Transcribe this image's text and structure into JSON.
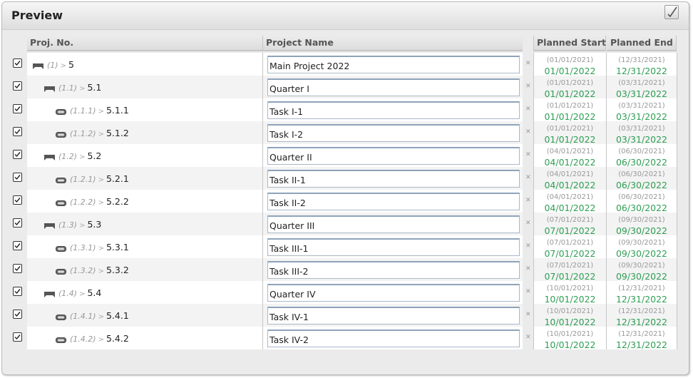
{
  "window": {
    "title": "Preview"
  },
  "columns": {
    "proj_no": "Proj. No.",
    "project_name": "Project Name",
    "planned_start": "Planned Start",
    "planned_end": "Planned End"
  },
  "rows": [
    {
      "checked": true,
      "type": "summary",
      "level": 0,
      "wbs": "(1)",
      "num": "5",
      "name": "Main Project 2022",
      "start_old": "(01/01/2021)",
      "start_new": "01/01/2022",
      "end_old": "(12/31/2021)",
      "end_new": "12/31/2022"
    },
    {
      "checked": true,
      "type": "summary",
      "level": 1,
      "wbs": "(1.1)",
      "num": "5.1",
      "name": "Quarter I",
      "start_old": "(01/01/2021)",
      "start_new": "01/01/2022",
      "end_old": "(03/31/2021)",
      "end_new": "03/31/2022"
    },
    {
      "checked": true,
      "type": "task",
      "level": 2,
      "wbs": "(1.1.1)",
      "num": "5.1.1",
      "name": "Task I-1",
      "start_old": "(01/01/2021)",
      "start_new": "01/01/2022",
      "end_old": "(03/31/2021)",
      "end_new": "03/31/2022"
    },
    {
      "checked": true,
      "type": "task",
      "level": 2,
      "wbs": "(1.1.2)",
      "num": "5.1.2",
      "name": "Task I-2",
      "start_old": "(01/01/2021)",
      "start_new": "01/01/2022",
      "end_old": "(03/31/2021)",
      "end_new": "03/31/2022"
    },
    {
      "checked": true,
      "type": "summary",
      "level": 1,
      "wbs": "(1.2)",
      "num": "5.2",
      "name": "Quarter II",
      "start_old": "(04/01/2021)",
      "start_new": "04/01/2022",
      "end_old": "(06/30/2021)",
      "end_new": "06/30/2022"
    },
    {
      "checked": true,
      "type": "task",
      "level": 2,
      "wbs": "(1.2.1)",
      "num": "5.2.1",
      "name": "Task II-1",
      "start_old": "(04/01/2021)",
      "start_new": "04/01/2022",
      "end_old": "(06/30/2021)",
      "end_new": "06/30/2022"
    },
    {
      "checked": true,
      "type": "task",
      "level": 2,
      "wbs": "(1.2.2)",
      "num": "5.2.2",
      "name": "Task II-2",
      "start_old": "(04/01/2021)",
      "start_new": "04/01/2022",
      "end_old": "(06/30/2021)",
      "end_new": "06/30/2022"
    },
    {
      "checked": true,
      "type": "summary",
      "level": 1,
      "wbs": "(1.3)",
      "num": "5.3",
      "name": "Quarter III",
      "start_old": "(07/01/2021)",
      "start_new": "07/01/2022",
      "end_old": "(09/30/2021)",
      "end_new": "09/30/2022"
    },
    {
      "checked": true,
      "type": "task",
      "level": 2,
      "wbs": "(1.3.1)",
      "num": "5.3.1",
      "name": "Task III-1",
      "start_old": "(07/01/2021)",
      "start_new": "07/01/2022",
      "end_old": "(09/30/2021)",
      "end_new": "09/30/2022"
    },
    {
      "checked": true,
      "type": "task",
      "level": 2,
      "wbs": "(1.3.2)",
      "num": "5.3.2",
      "name": "Task III-2",
      "start_old": "(07/01/2021)",
      "start_new": "07/01/2022",
      "end_old": "(09/30/2021)",
      "end_new": "09/30/2022"
    },
    {
      "checked": true,
      "type": "summary",
      "level": 1,
      "wbs": "(1.4)",
      "num": "5.4",
      "name": "Quarter IV",
      "start_old": "(10/01/2021)",
      "start_new": "10/01/2022",
      "end_old": "(12/31/2021)",
      "end_new": "12/31/2022"
    },
    {
      "checked": true,
      "type": "task",
      "level": 2,
      "wbs": "(1.4.1)",
      "num": "5.4.1",
      "name": "Task IV-1",
      "start_old": "(10/01/2021)",
      "start_new": "10/01/2022",
      "end_old": "(12/31/2021)",
      "end_new": "12/31/2022"
    },
    {
      "checked": true,
      "type": "task",
      "level": 2,
      "wbs": "(1.4.2)",
      "num": "5.4.2",
      "name": "Task IV-2",
      "start_old": "(10/01/2021)",
      "start_new": "10/01/2022",
      "end_old": "(12/31/2021)",
      "end_new": "12/31/2022"
    }
  ],
  "icons": {
    "summary": "summary-task-icon",
    "task": "task-bar-icon",
    "remove": "remove-x-icon",
    "checkbox": "checkbox-checked-icon",
    "confirm": "checkmark-icon"
  },
  "colors": {
    "new_date": "#2e9e54",
    "old_date": "#999999",
    "panel_bg": "#ebebeb"
  }
}
